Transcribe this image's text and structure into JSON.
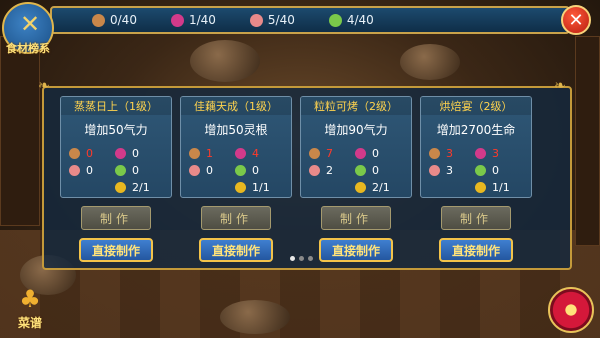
{
  "header": {
    "badge_label": "食材榜系",
    "resources": [
      {
        "icon": "mushroom-icon",
        "value": "0/40"
      },
      {
        "icon": "flower-icon",
        "value": "1/40"
      },
      {
        "icon": "meat-icon",
        "value": "5/40"
      },
      {
        "icon": "herb-icon",
        "value": "4/40"
      }
    ],
    "close_label": "✕"
  },
  "cards": [
    {
      "title": "蒸蒸日上（1级）",
      "effect": "增加50气力",
      "ingredients": [
        {
          "icon": "mushroom-icon",
          "value": "0",
          "insufficient": true
        },
        {
          "icon": "flower-icon",
          "value": "0",
          "insufficient": false
        },
        {
          "icon": "meat-icon",
          "value": "0",
          "insufficient": false
        },
        {
          "icon": "herb-icon",
          "value": "0",
          "insufficient": false
        }
      ],
      "coin": "2/1",
      "make_label": "制作",
      "direct_label": "直接制作"
    },
    {
      "title": "佳藕天成（1级）",
      "effect": "增加50灵根",
      "ingredients": [
        {
          "icon": "mushroom-icon",
          "value": "1",
          "insufficient": true
        },
        {
          "icon": "flower-icon",
          "value": "4",
          "insufficient": true
        },
        {
          "icon": "meat-icon",
          "value": "0",
          "insufficient": false
        },
        {
          "icon": "herb-icon",
          "value": "0",
          "insufficient": false
        }
      ],
      "coin": "1/1",
      "make_label": "制作",
      "direct_label": "直接制作"
    },
    {
      "title": "粒粒可烤（2级）",
      "effect": "增加90气力",
      "ingredients": [
        {
          "icon": "mushroom-icon",
          "value": "7",
          "insufficient": true
        },
        {
          "icon": "flower-icon",
          "value": "0",
          "insufficient": false
        },
        {
          "icon": "meat-icon",
          "value": "2",
          "insufficient": false
        },
        {
          "icon": "herb-icon",
          "value": "0",
          "insufficient": false
        }
      ],
      "coin": "2/1",
      "make_label": "制作",
      "direct_label": "直接制作"
    },
    {
      "title": "烘焙宴（2级）",
      "effect": "增加2700生命",
      "ingredients": [
        {
          "icon": "mushroom-icon",
          "value": "3",
          "insufficient": true
        },
        {
          "icon": "flower-icon",
          "value": "3",
          "insufficient": true
        },
        {
          "icon": "meat-icon",
          "value": "3",
          "insufficient": false
        },
        {
          "icon": "herb-icon",
          "value": "0",
          "insufficient": false
        }
      ],
      "coin": "1/1",
      "make_label": "制作",
      "direct_label": "直接制作"
    }
  ],
  "pagination": {
    "pages": 3,
    "active": 1
  },
  "footer": {
    "menu_label": "菜谱"
  },
  "colors": {
    "mushroom": "#c9874a",
    "flower": "#d23a8a",
    "meat": "#e88a8a",
    "herb": "#7ac94a",
    "coin": "#e8b820"
  }
}
